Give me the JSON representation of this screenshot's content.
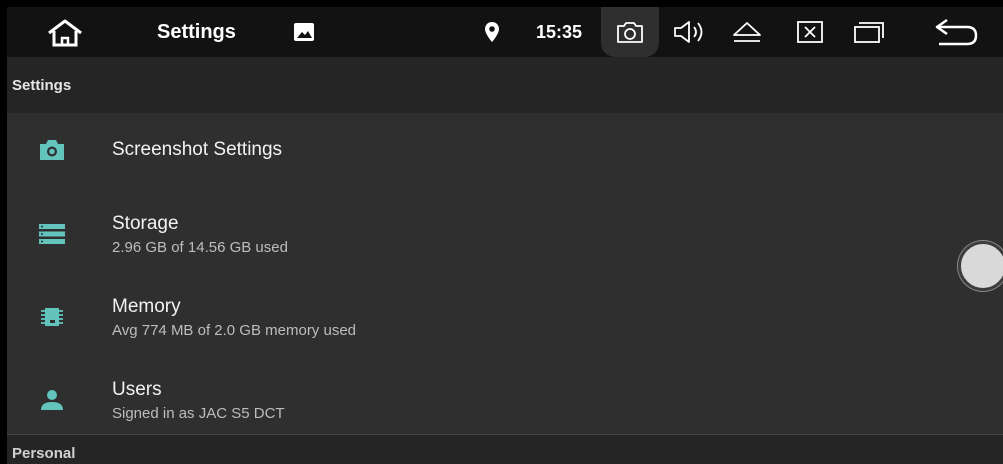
{
  "status_bar": {
    "app_title": "Settings",
    "clock": "15:35",
    "icons": [
      "home-icon",
      "image-icon",
      "location-icon",
      "camera-icon",
      "volume-icon",
      "eject-icon",
      "close-box-icon",
      "recent-apps-icon",
      "back-icon"
    ]
  },
  "header": {
    "title": "Settings"
  },
  "items": [
    {
      "icon": "camera-icon",
      "title": "Screenshot Settings",
      "subtitle": ""
    },
    {
      "icon": "storage-icon",
      "title": "Storage",
      "subtitle": "2.96 GB of 14.56 GB used"
    },
    {
      "icon": "memory-icon",
      "title": "Memory",
      "subtitle": "Avg 774 MB of 2.0 GB memory used"
    },
    {
      "icon": "user-icon",
      "title": "Users",
      "subtitle": "Signed in as JAC S5 DCT"
    }
  ],
  "sections": {
    "personal": "Personal"
  },
  "colors": {
    "accent": "#62c4bc",
    "background": "#2f2f2f",
    "statusbar": "#121212",
    "header": "#252525"
  }
}
